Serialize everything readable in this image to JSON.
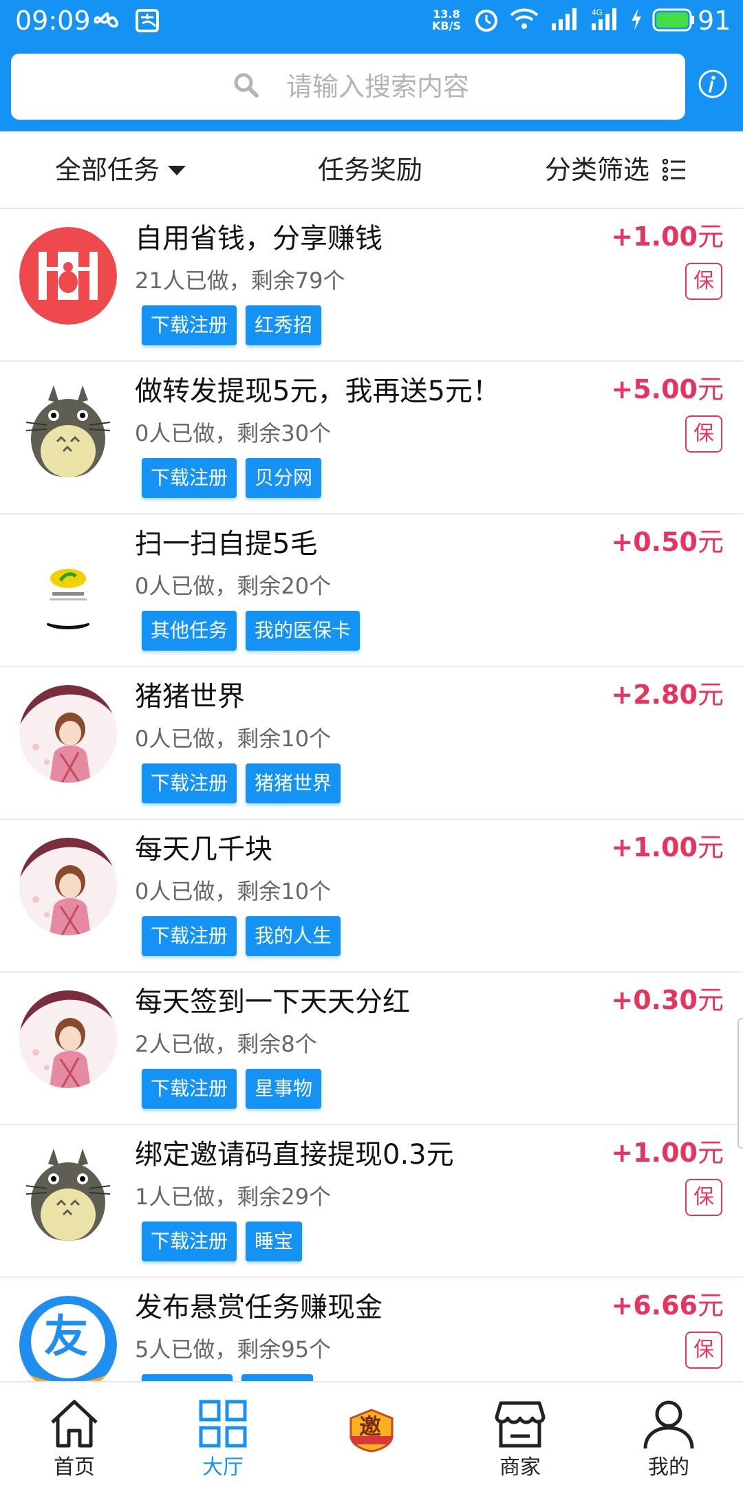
{
  "status_bar": {
    "time": "09:09",
    "net_speed_value": "13.8",
    "net_speed_unit": "KB/S",
    "battery": "91",
    "icons": [
      "infinity-icon",
      "alipay-icon",
      "alarm-icon",
      "wifi-icon",
      "signal-icon",
      "signal-4g-icon",
      "charging-icon",
      "battery-icon"
    ]
  },
  "search": {
    "placeholder": "请输入搜索内容"
  },
  "tabs": {
    "all": "全部任务",
    "reward": "任务奖励",
    "filter": "分类筛选"
  },
  "tasks": [
    {
      "title": "自用省钱，分享赚钱",
      "meta": "21人已做，剩余79个",
      "tags": [
        "下载注册",
        "红秀招"
      ],
      "amount": "+1.00",
      "unit": "元",
      "guarantee": "保",
      "avatar": "hongxiu-logo"
    },
    {
      "title": "做转发提现5元，我再送5元！",
      "meta": "0人已做，剩余30个",
      "tags": [
        "下载注册",
        "贝分网"
      ],
      "amount": "+5.00",
      "unit": "元",
      "guarantee": "保",
      "avatar": "totoro-avatar"
    },
    {
      "title": "扫一扫自提5毛",
      "meta": "0人已做，剩余20个",
      "tags": [
        "其他任务",
        "我的医保卡"
      ],
      "amount": "+0.50",
      "unit": "元",
      "guarantee": "",
      "avatar": "qq-music-logo"
    },
    {
      "title": "猪猪世界",
      "meta": "0人已做，剩余10个",
      "tags": [
        "下载注册",
        "猪猪世界"
      ],
      "amount": "+2.80",
      "unit": "元",
      "guarantee": "",
      "avatar": "anime-girl-avatar"
    },
    {
      "title": "每天几千块",
      "meta": "0人已做，剩余10个",
      "tags": [
        "下载注册",
        "我的人生"
      ],
      "amount": "+1.00",
      "unit": "元",
      "guarantee": "",
      "avatar": "anime-girl-avatar"
    },
    {
      "title": "每天签到一下天天分红",
      "meta": "2人已做，剩余8个",
      "tags": [
        "下载注册",
        "星事物"
      ],
      "amount": "+0.30",
      "unit": "元",
      "guarantee": "",
      "avatar": "anime-girl-avatar"
    },
    {
      "title": "绑定邀请码直接提现0.3元",
      "meta": "1人已做，剩余29个",
      "tags": [
        "下载注册",
        "睡宝"
      ],
      "amount": "+1.00",
      "unit": "元",
      "guarantee": "保",
      "avatar": "totoro-avatar"
    },
    {
      "title": "发布悬赏任务赚现金",
      "meta": "5人已做，剩余95个",
      "tags": [
        "",
        ""
      ],
      "amount": "+6.66",
      "unit": "元",
      "guarantee": "保",
      "avatar": "you-logo",
      "avatar_text": "友"
    }
  ],
  "bottom_nav": {
    "home": "首页",
    "hall": "大厅",
    "center_badge": "邀",
    "merchant": "商家",
    "mine": "我的"
  },
  "colors": {
    "primary": "#1593f5",
    "price": "#e8335c",
    "text": "#111111",
    "meta": "#666666"
  }
}
